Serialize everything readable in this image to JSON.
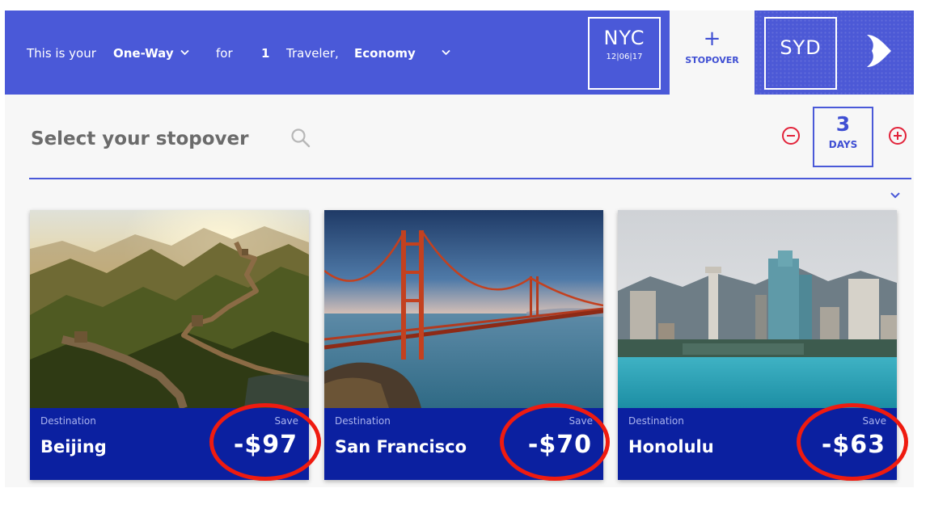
{
  "header": {
    "prefix": "This is your",
    "trip_type": "One-Way",
    "for_label": "for",
    "traveler_count": "1",
    "traveler_label": "Traveler,",
    "cabin_class": "Economy",
    "origin": {
      "code": "NYC",
      "date": "12|06|17"
    },
    "stopover": {
      "plus": "+",
      "label": "STOPOVER"
    },
    "destination": {
      "code": "SYD"
    }
  },
  "search": {
    "title": "Select your stopover",
    "days_value": "3",
    "days_unit": "DAYS"
  },
  "cards": [
    {
      "destination_label": "Destination",
      "save_label": "Save",
      "city": "Beijing",
      "price": "-$97"
    },
    {
      "destination_label": "Destination",
      "save_label": "Save",
      "city": "San Francisco",
      "price": "-$70"
    },
    {
      "destination_label": "Destination",
      "save_label": "Save",
      "city": "Honolulu",
      "price": "-$63"
    }
  ],
  "colors": {
    "header_blue": "#4a59d8",
    "card_blue": "#0b20a0",
    "stepper_red": "#e2233a",
    "highlight_red": "#ef1b10"
  }
}
